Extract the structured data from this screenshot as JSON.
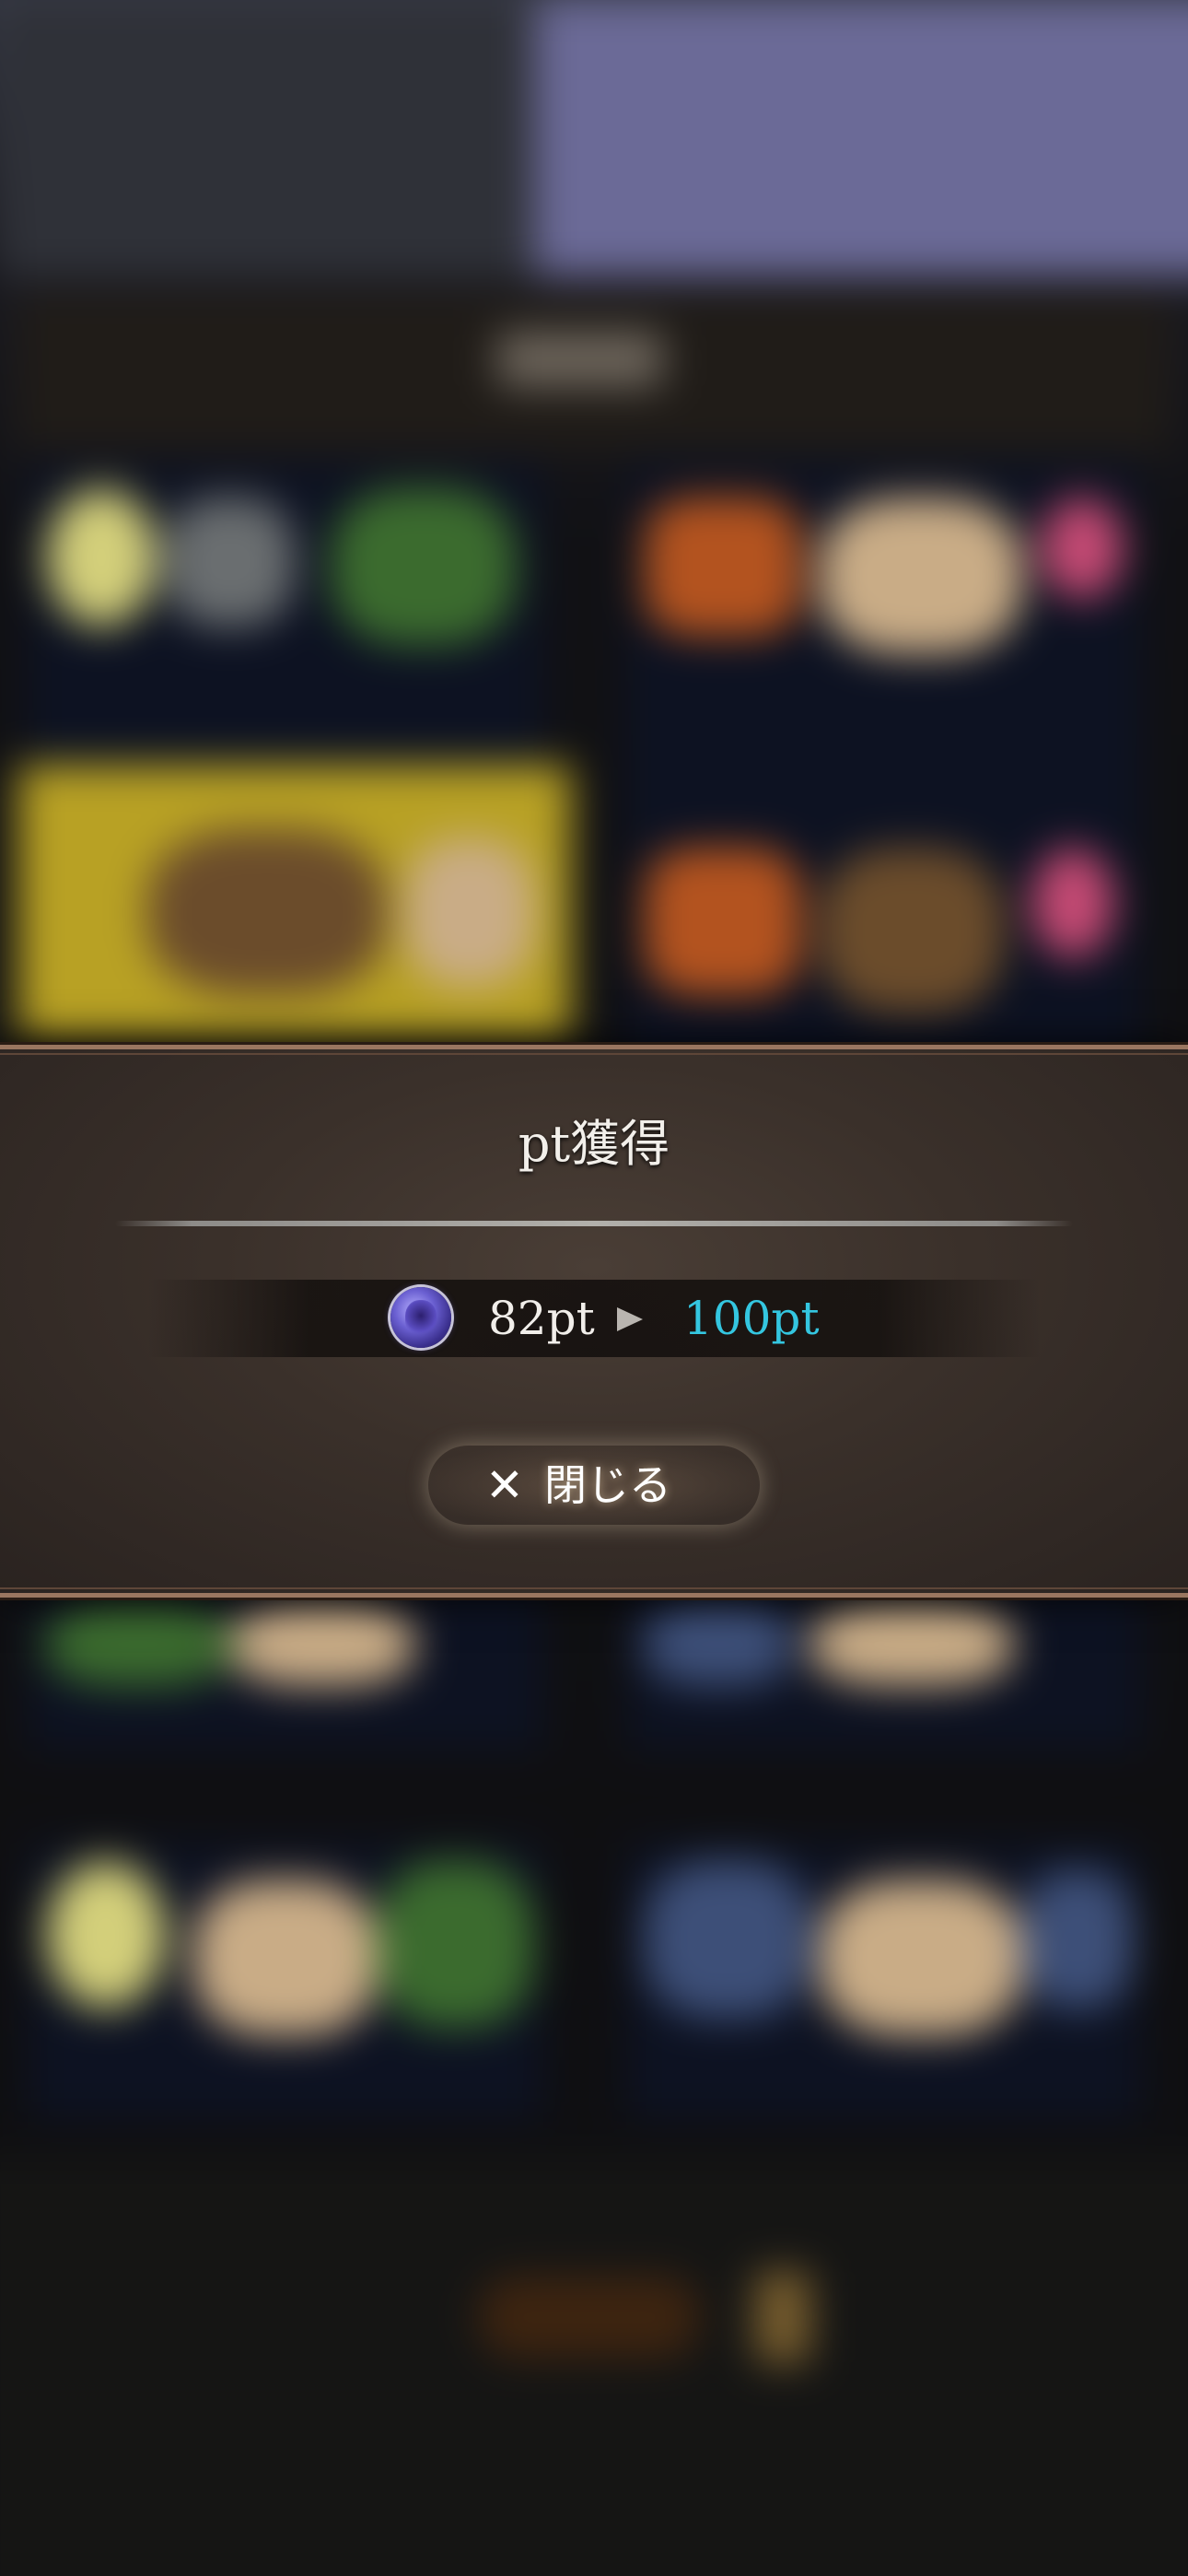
{
  "modal": {
    "title": "pt獲得",
    "points": {
      "before": "82pt",
      "after": "100pt",
      "icon": "purple-orb-icon",
      "after_color": "#34c6e0"
    },
    "close_button": {
      "icon": "close-icon",
      "icon_glyph": "✕",
      "label": "閉じる"
    }
  },
  "colors": {
    "panel_background": "#3a302a",
    "panel_border": "#9a7660",
    "highlight_cyan": "#34c6e0"
  }
}
